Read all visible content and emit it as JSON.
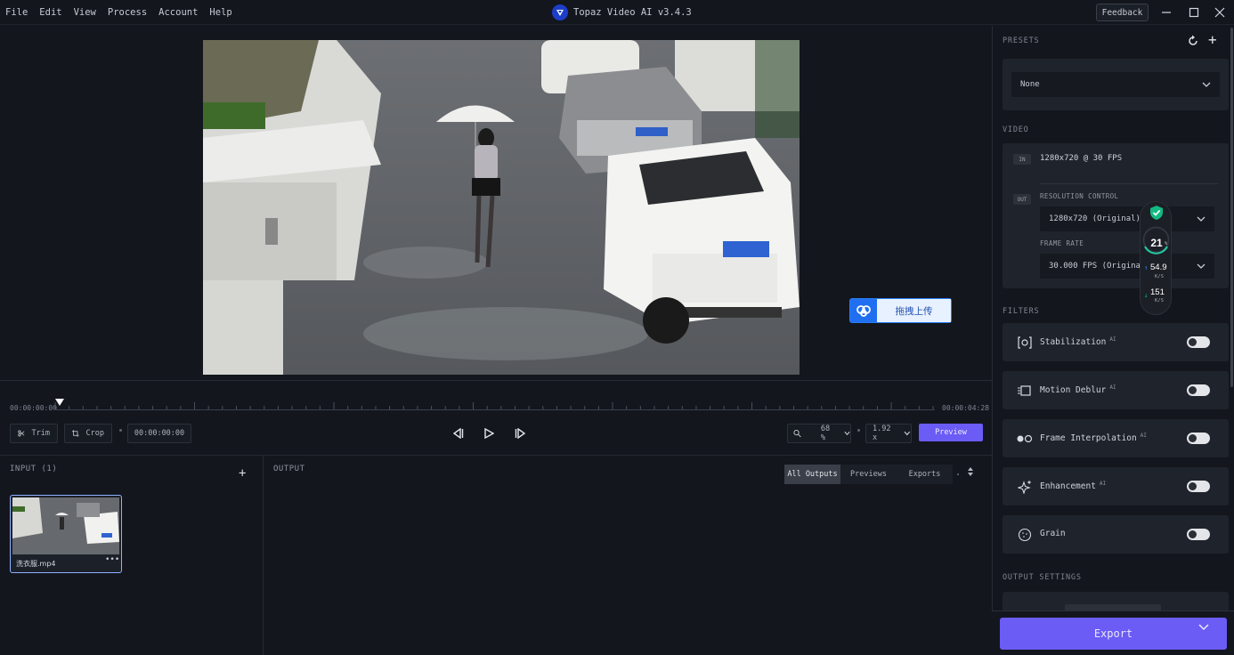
{
  "menu": [
    "File",
    "Edit",
    "View",
    "Process",
    "Account",
    "Help"
  ],
  "app": {
    "title": "Topaz Video AI  v3.4.3",
    "feedback": "Feedback"
  },
  "upload_widget": {
    "label": "拖拽上传"
  },
  "timeline": {
    "start": "00:00:00:00",
    "end": "00:00:04:28"
  },
  "controls": {
    "trim": "Trim",
    "crop": "Crop",
    "timecode": "00:00:00:00",
    "zoom": "68 %",
    "speed": "1.92 x",
    "preview": "Preview"
  },
  "input": {
    "title": "INPUT (1)",
    "file_name": "洗衣服.mp4",
    "more": "•••"
  },
  "output": {
    "title": "OUTPUT",
    "tabs": [
      "All Outputs",
      "Previews",
      "Exports"
    ],
    "active_tab": "All Outputs"
  },
  "sidebar": {
    "presets_title": "PRESETS",
    "preset_value": "None",
    "video_title": "VIDEO",
    "in_tag": "IN",
    "in_value": "1280x720 @ 30 FPS",
    "out_tag": "OUT",
    "resolution_label": "RESOLUTION CONTROL",
    "resolution_value": "1280x720 (Original)",
    "framerate_label": "FRAME RATE",
    "framerate_value": "30.000 FPS (Original)",
    "filters_title": "FILTERS",
    "filters": [
      {
        "label": "Stabilization",
        "ai": "AI",
        "icon": "stabilization-icon",
        "enabled": false
      },
      {
        "label": "Motion Deblur",
        "ai": "AI",
        "icon": "motion-deblur-icon",
        "enabled": false
      },
      {
        "label": "Frame Interpolation",
        "ai": "AI",
        "icon": "frame-interpolation-icon",
        "enabled": false
      },
      {
        "label": "Enhancement",
        "ai": "AI",
        "icon": "enhancement-icon",
        "enabled": false
      },
      {
        "label": "Grain",
        "ai": "",
        "icon": "grain-icon",
        "enabled": false
      }
    ],
    "output_settings_title": "OUTPUT SETTINGS",
    "export": "Export"
  },
  "meter": {
    "cpu": "21",
    "cpu_unit": "%",
    "up": "54.9",
    "up_unit": "K/S",
    "down": "151",
    "down_unit": "K/S"
  },
  "colors": {
    "accent": "#6a5cf5",
    "panel": "#1f232b",
    "background": "#13161d"
  }
}
